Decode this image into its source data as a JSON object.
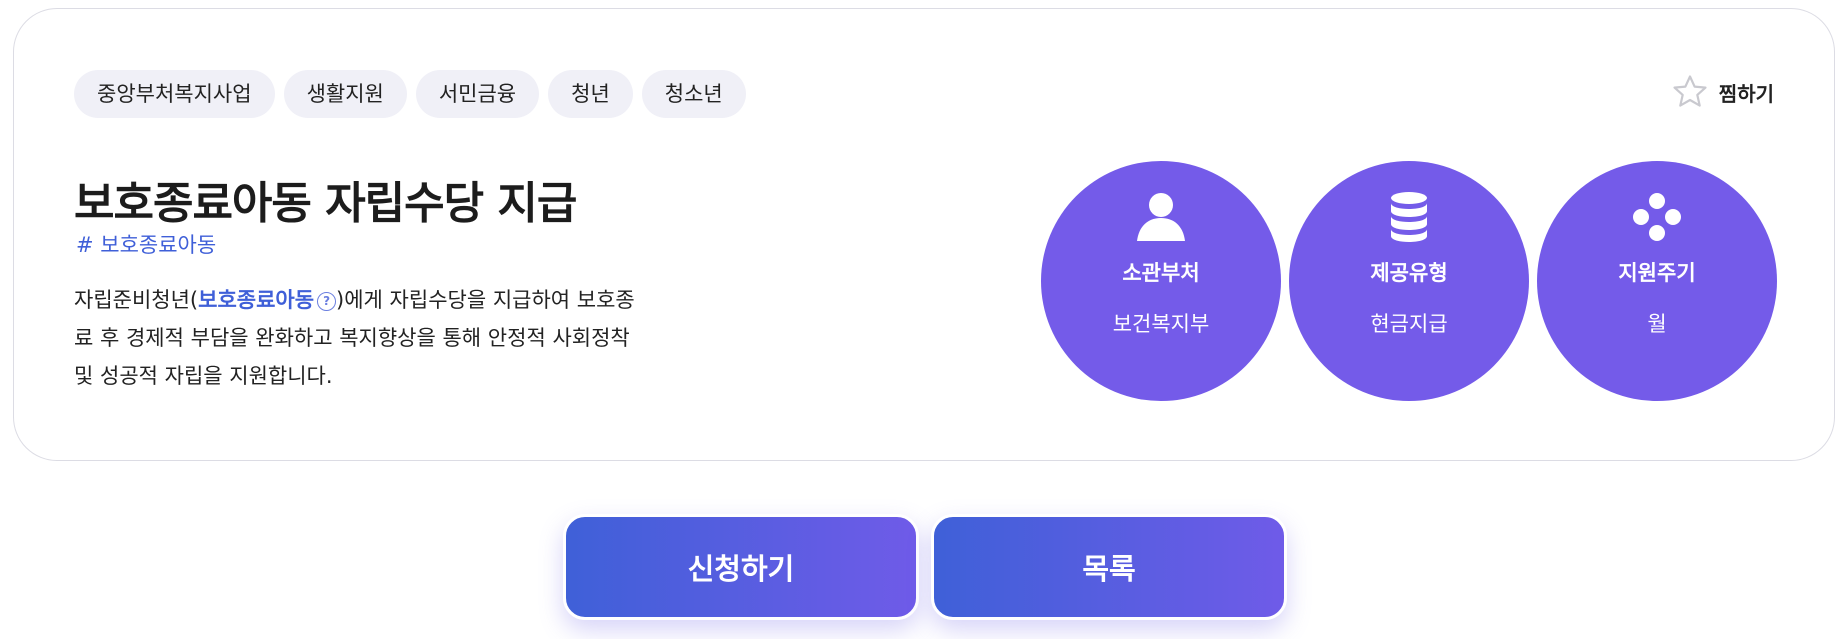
{
  "tags": [
    "중앙부처복지사업",
    "생활지원",
    "서민금융",
    "청년",
    "청소년"
  ],
  "bookmark": {
    "label": "찜하기",
    "icon": "star-outline-icon"
  },
  "title": "보호종료아동 자립수당 지급",
  "hashtag": "# 보호종료아동",
  "description": {
    "before": "자립준비청년(",
    "term": "보호종료아동",
    "after": ")에게 자립수당을 지급하여 보호종료 후 경제적 부담을 완화하고 복지향상을 통해 안정적 사회정착 및 성공적 자립을 지원합니다."
  },
  "info_circles": [
    {
      "icon": "person-icon",
      "label": "소관부처",
      "value": "보건복지부"
    },
    {
      "icon": "database-stack-icon",
      "label": "제공유형",
      "value": "현금지급"
    },
    {
      "icon": "four-dots-icon",
      "label": "지원주기",
      "value": "월"
    }
  ],
  "buttons": {
    "apply": "신청하기",
    "list": "목록"
  },
  "colors": {
    "accent": "#745be9",
    "link": "#3f5fd8",
    "tag_bg": "#f0f0f7",
    "button_gradient_start": "#3f60d8",
    "button_gradient_end": "#6f5be8"
  }
}
